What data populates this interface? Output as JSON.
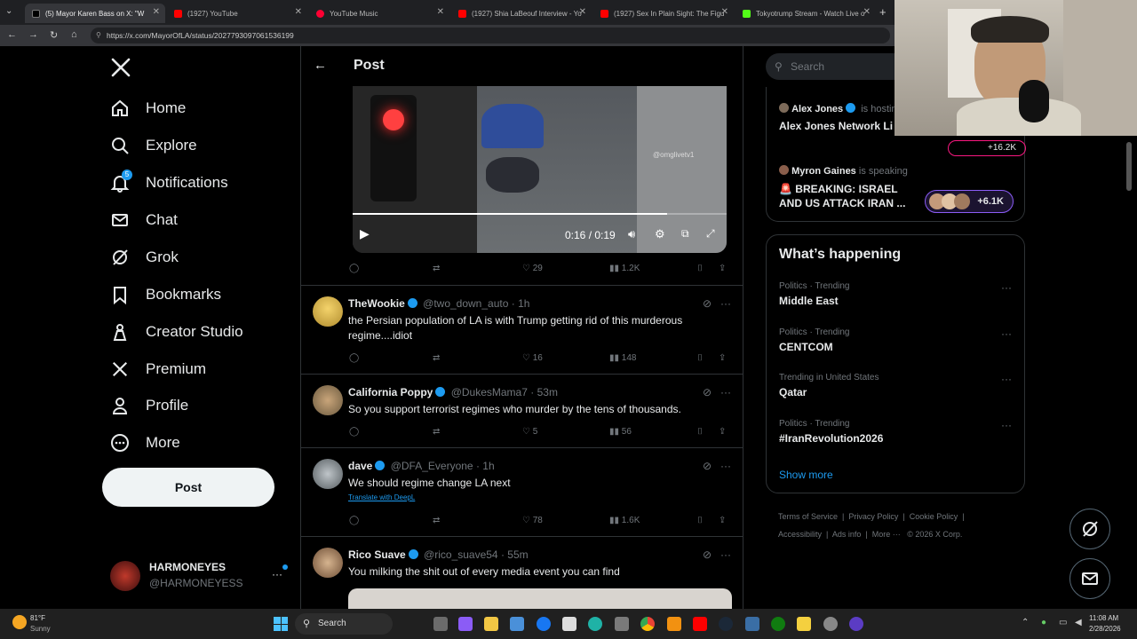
{
  "browser": {
    "tabs": [
      {
        "title": "(5) Mayor Karen Bass on X: \"W",
        "active": true
      },
      {
        "title": "(1927) YouTube"
      },
      {
        "title": "YouTube Music"
      },
      {
        "title": "(1927) Shia LaBeouf Interview - Yo"
      },
      {
        "title": "(1927) Sex In Plain Sight: The Figu"
      },
      {
        "title": "Tokyotrump Stream - Watch Live o"
      }
    ],
    "url": "https://x.com/MayorOfLA/status/2027793097061536199"
  },
  "nav": {
    "items": [
      {
        "label": "Home",
        "icon": "home-icon"
      },
      {
        "label": "Explore",
        "icon": "search-icon"
      },
      {
        "label": "Notifications",
        "icon": "bell-icon",
        "badge": "5"
      },
      {
        "label": "Chat",
        "icon": "mail-icon"
      },
      {
        "label": "Grok",
        "icon": "grok-icon"
      },
      {
        "label": "Bookmarks",
        "icon": "bookmark-icon"
      },
      {
        "label": "Creator Studio",
        "icon": "creator-icon"
      },
      {
        "label": "Premium",
        "icon": "x-icon"
      },
      {
        "label": "Profile",
        "icon": "person-icon"
      },
      {
        "label": "More",
        "icon": "more-icon"
      }
    ],
    "post_label": "Post",
    "account": {
      "name": "HARMONEYES",
      "handle": "@HARMONEYESS"
    }
  },
  "post": {
    "header": "Post",
    "video": {
      "watermark": "@omglivetv1",
      "time": "0:16 / 0:19",
      "progress": 0.84
    },
    "stats": {
      "likes": "29",
      "views": "1.2K"
    }
  },
  "replies": [
    {
      "name": "TheWookie",
      "handle": "@two_down_auto",
      "time": "1h",
      "text": "the Persian population of LA is with Trump getting rid of this murderous regime....idiot",
      "likes": "16",
      "views": "148"
    },
    {
      "name": "California Poppy",
      "handle": "@DukesMama7",
      "time": "53m",
      "text": "So you support terrorist regimes who murder by the tens of thousands.",
      "likes": "5",
      "views": "56"
    },
    {
      "name": "dave",
      "handle": "@DFA_Everyone",
      "time": "1h",
      "text": "We should regime change LA next",
      "translate": "Translate with DeepL",
      "likes": "78",
      "views": "1.6K"
    },
    {
      "name": "Rico Suave",
      "handle": "@rico_suave54",
      "time": "55m",
      "text": "You milking the shit out of every media event you can find"
    }
  ],
  "right": {
    "search_placeholder": "Search",
    "spaces": [
      {
        "host": "Alex Jones",
        "status": "is hosting",
        "title": "Alex Jones Network Li",
        "count": "+16.2K"
      },
      {
        "host": "Myron Gaines",
        "status": "is speaking",
        "title": "🚨 BREAKING: ISRAEL AND US ATTACK IRAN ...",
        "count": "+6.1K"
      }
    ],
    "happening_title": "What’s happening",
    "trends": [
      {
        "category": "Politics · Trending",
        "name": "Middle East"
      },
      {
        "category": "Politics · Trending",
        "name": "CENTCOM"
      },
      {
        "category": "Trending in United States",
        "name": "Qatar"
      },
      {
        "category": "Politics · Trending",
        "name": "#IranRevolution2026"
      }
    ],
    "show_more": "Show more",
    "footer": [
      "Terms of Service",
      "Privacy Policy",
      "Cookie Policy",
      "Accessibility",
      "Ads info",
      "More ···",
      "© 2026 X Corp."
    ]
  },
  "taskbar": {
    "weather_temp": "81°F",
    "weather_desc": "Sunny",
    "search_label": "Search",
    "time": "11:08 AM",
    "date": "2/28/2026"
  },
  "colors": {
    "accent": "#1d9bf0",
    "background": "#000000",
    "border": "#2f3336",
    "muted": "#71767b"
  }
}
